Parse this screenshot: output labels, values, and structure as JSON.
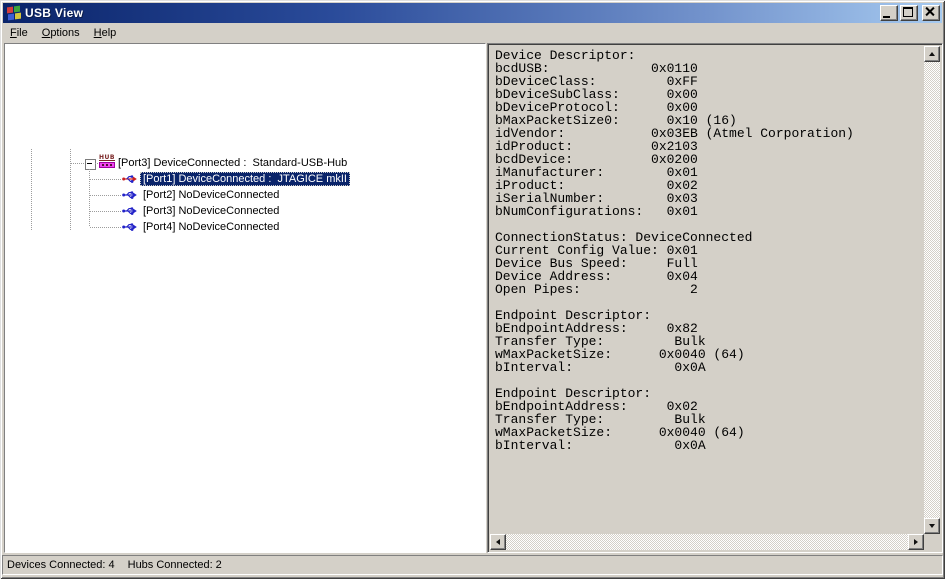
{
  "window": {
    "title": "USB View"
  },
  "menu": {
    "items": [
      {
        "hot": "F",
        "rest": "ile"
      },
      {
        "hot": "O",
        "rest": "ptions"
      },
      {
        "hot": "H",
        "rest": "elp"
      }
    ]
  },
  "tree": {
    "hub": {
      "label": "[Port3] DeviceConnected :  Standard-USB-Hub",
      "icon_text": "HUB",
      "expander_state": "-"
    },
    "ports": [
      {
        "label": "[Port1] DeviceConnected :  JTAGICE mkII",
        "selected": true,
        "icon": "usb-device-connected-icon"
      },
      {
        "label": "[Port2] NoDeviceConnected",
        "selected": false,
        "icon": "usb-no-device-icon"
      },
      {
        "label": "[Port3] NoDeviceConnected",
        "selected": false,
        "icon": "usb-no-device-icon"
      },
      {
        "label": "[Port4] NoDeviceConnected",
        "selected": false,
        "icon": "usb-no-device-icon"
      }
    ]
  },
  "details": {
    "text": "Device Descriptor:\nbcdUSB:             0x0110\nbDeviceClass:         0xFF\nbDeviceSubClass:      0x00\nbDeviceProtocol:      0x00\nbMaxPacketSize0:      0x10 (16)\nidVendor:           0x03EB (Atmel Corporation)\nidProduct:          0x2103\nbcdDevice:          0x0200\niManufacturer:        0x01\niProduct:             0x02\niSerialNumber:        0x03\nbNumConfigurations:   0x01\n\nConnectionStatus: DeviceConnected\nCurrent Config Value: 0x01\nDevice Bus Speed:     Full\nDevice Address:       0x04\nOpen Pipes:              2\n\nEndpoint Descriptor:\nbEndpointAddress:     0x82\nTransfer Type:         Bulk\nwMaxPacketSize:      0x0040 (64)\nbInterval:             0x0A\n\nEndpoint Descriptor:\nbEndpointAddress:     0x02\nTransfer Type:         Bulk\nwMaxPacketSize:      0x0040 (64)\nbInterval:             0x0A"
  },
  "status_bar": {
    "devices": "Devices Connected: 4",
    "hubs": "Hubs Connected: 2"
  },
  "colors": {
    "title_gradient_start": "#0A246A",
    "title_gradient_end": "#A6CAF0",
    "chrome": "#D4D0C8",
    "selection_background": "#0A246A",
    "selection_text": "#FFFFFF",
    "tree_background": "#FFFFFF",
    "details_background": "#D4D0C8",
    "usb_icon_blue": "#2323C8",
    "usb_icon_red": "#CC2020",
    "hub_bar_magenta": "#F048F0"
  },
  "icons": [
    "app-icon",
    "minimize-icon",
    "maximize-icon",
    "close-icon",
    "hub-icon",
    "usb-device-connected-icon",
    "usb-no-device-icon",
    "expand-collapse-icon",
    "up-arrow-icon",
    "down-arrow-icon",
    "left-arrow-icon",
    "right-arrow-icon"
  ]
}
